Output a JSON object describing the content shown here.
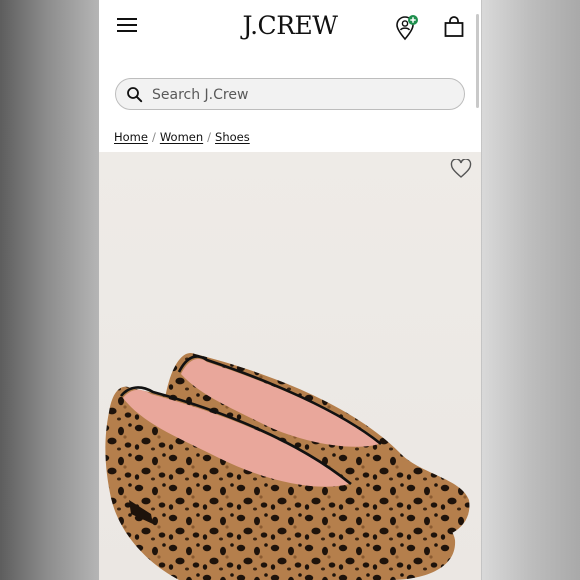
{
  "header": {
    "logo_text": "J.CREW",
    "menu_icon": "hamburger-menu-icon",
    "account_icon": "account-location-icon",
    "bag_icon": "shopping-bag-icon",
    "account_badge_color": "#1f8f4e"
  },
  "search": {
    "placeholder": "Search J.Crew",
    "value": ""
  },
  "breadcrumb": {
    "items": [
      "Home",
      "Women",
      "Shoes"
    ],
    "separator": "/"
  },
  "product": {
    "wishlist_icon": "heart-outline-icon",
    "image_background": "#ece8e4",
    "lining_color": "#e9a79b",
    "print_base_color": "#b57f4c",
    "spot_color": "#1e130b",
    "trim_color": "#111111"
  }
}
